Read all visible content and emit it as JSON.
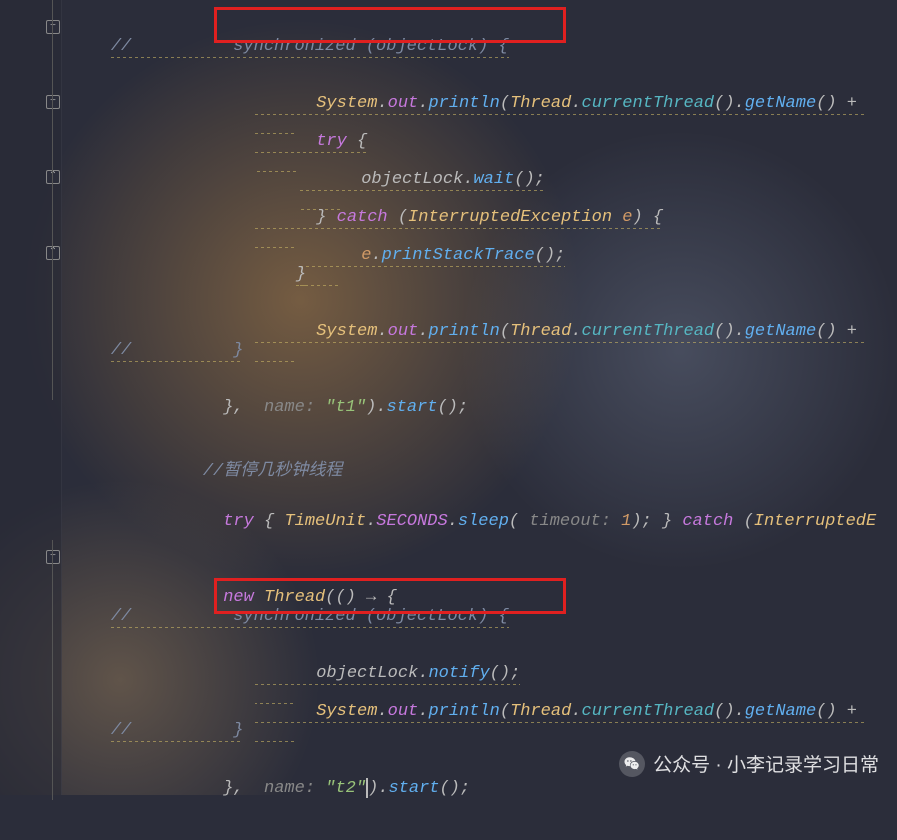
{
  "code": {
    "l1": "//          synchronized (objectLock) {",
    "l2_a": "System",
    "l2_b": ".",
    "l2_c": "out",
    "l2_d": ".",
    "l2_e": "println",
    "l2_f": "(",
    "l2_g": "Thread",
    "l2_h": ".",
    "l2_i": "currentThread",
    "l2_j": "().",
    "l2_k": "getName",
    "l2_l": "() + ",
    "l3_a": "try",
    "l3_b": " {",
    "l4_a": "objectLock",
    "l4_b": ".",
    "l4_c": "wait",
    "l4_d": "();",
    "l5_a": "} ",
    "l5_b": "catch",
    "l5_c": " (",
    "l5_d": "InterruptedException",
    "l5_e": " ",
    "l5_f": "e",
    "l5_g": ") {",
    "l6_a": "e",
    "l6_b": ".",
    "l6_c": "printStackTrace",
    "l6_d": "();",
    "l7": "}",
    "l8_a": "System",
    "l8_b": ".",
    "l8_c": "out",
    "l8_d": ".",
    "l8_e": "println",
    "l8_f": "(",
    "l8_g": "Thread",
    "l8_h": ".",
    "l8_i": "currentThread",
    "l8_j": "().",
    "l8_k": "getName",
    "l8_l": "() + ",
    "l9": "//          }",
    "l10_a": "}, ",
    "l10_b": " name: ",
    "l10_c": "\"t1\"",
    "l10_d": ").",
    "l10_e": "start",
    "l10_f": "();",
    "l11": "//暂停几秒钟线程",
    "l12_a": "try",
    "l12_b": " { ",
    "l12_c": "TimeUnit",
    "l12_d": ".",
    "l12_e": "SECONDS",
    "l12_f": ".",
    "l12_g": "sleep",
    "l12_h": "(",
    "l12_i": " timeout: ",
    "l12_j": "1",
    "l12_k": "); } ",
    "l12_l": "catch",
    "l12_m": " (",
    "l12_n": "InterruptedE",
    "l13_a": "new",
    "l13_b": " ",
    "l13_c": "Thread",
    "l13_d": "(() → {",
    "l14": "//          synchronized (objectLock) {",
    "l15_a": "objectLock",
    "l15_b": ".",
    "l15_c": "notify",
    "l15_d": "();",
    "l16_a": "System",
    "l16_b": ".",
    "l16_c": "out",
    "l16_d": ".",
    "l16_e": "println",
    "l16_f": "(",
    "l16_g": "Thread",
    "l16_h": ".",
    "l16_i": "currentThread",
    "l16_j": "().",
    "l16_k": "getName",
    "l16_l": "() + ",
    "l17": "//          }",
    "l18_a": "}, ",
    "l18_b": " name: ",
    "l18_c": "\"t2\"",
    "l18_d": ").",
    "l18_e": "start",
    "l18_f": "();"
  },
  "watermark": {
    "text": "公众号 · 小李记录学习日常"
  },
  "fold_glyph_minus": "−",
  "fold_glyph_up": "⌃"
}
